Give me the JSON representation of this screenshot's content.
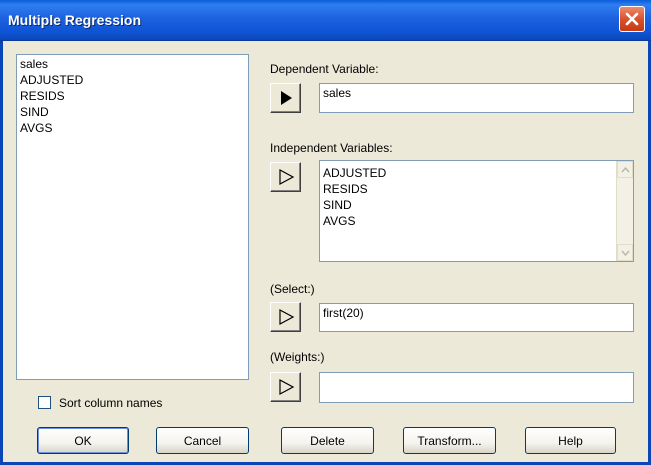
{
  "window": {
    "title": "Multiple Regression"
  },
  "variables_list": [
    "sales",
    "ADJUSTED",
    "RESIDS",
    "SIND",
    "AVGS"
  ],
  "sort_checkbox": {
    "label": "Sort column names",
    "checked": false
  },
  "dependent": {
    "label": "Dependent Variable:",
    "value": "sales"
  },
  "independent": {
    "label": "Independent Variables:",
    "values": [
      "ADJUSTED",
      "RESIDS",
      "SIND",
      "AVGS"
    ]
  },
  "select": {
    "label": "(Select:)",
    "value": "first(20)"
  },
  "weights": {
    "label": "(Weights:)",
    "value": ""
  },
  "buttons": {
    "ok": "OK",
    "cancel": "Cancel",
    "delete": "Delete",
    "transform": "Transform...",
    "help": "Help"
  },
  "colors": {
    "titlebar": "#0b46b8",
    "close": "#d9522c",
    "dialog_bg": "#ece9d8",
    "field_border": "#7f9db9"
  }
}
